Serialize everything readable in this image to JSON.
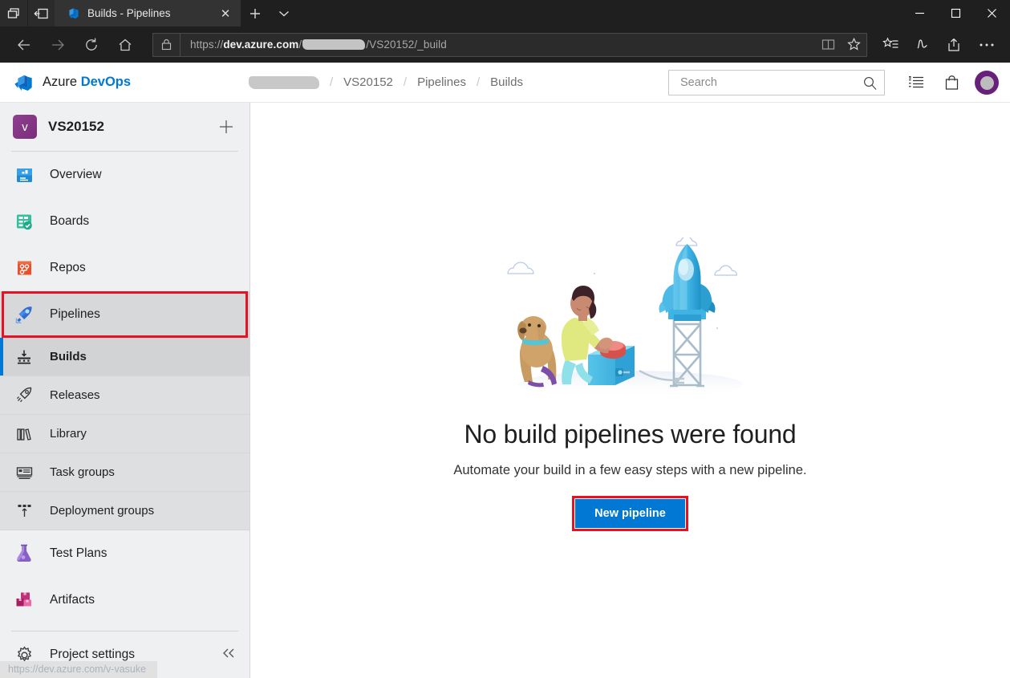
{
  "browser": {
    "tab": {
      "title": "Builds - Pipelines",
      "favicon_icon": "azure-devops-favicon",
      "close_icon": "close-icon"
    },
    "new_tab_label": "+",
    "tab_dropdown_icon": "chevron-down-icon",
    "titlebar_buttons": {
      "tabs_preview_icon": "tabs-preview-icon",
      "set_aside_icon": "set-tabs-aside-icon",
      "minimize": "—",
      "maximize": "□",
      "close": "✕"
    },
    "toolbar": {
      "back_icon": "back-arrow-icon",
      "forward_icon": "forward-arrow-icon",
      "refresh_icon": "refresh-icon",
      "home_icon": "home-icon",
      "lock_icon": "lock-icon",
      "reading_view_icon": "reading-view-icon",
      "favorite_icon": "star-icon",
      "hub_icon": "favorites-hub-icon",
      "notes_icon": "web-notes-icon",
      "share_icon": "share-icon",
      "more_icon": "more-ellipsis-icon"
    },
    "address": {
      "scheme": "https://",
      "domain": "dev.azure.com",
      "path_before_redaction": "/",
      "redacted_segment": true,
      "path_after_redaction": "/VS20152/_build"
    }
  },
  "ado_header": {
    "logo_icon": "azure-devops-logo",
    "brand_prefix": "Azure ",
    "brand_suffix": "DevOps",
    "breadcrumb": {
      "organization_redacted": true,
      "separator": "/",
      "items": [
        "VS20152",
        "Pipelines",
        "Builds"
      ]
    },
    "search": {
      "placeholder": "Search",
      "value": "",
      "icon": "search-icon"
    },
    "icons": [
      {
        "name": "backlog-list-icon",
        "label": "Work items"
      },
      {
        "name": "marketplace-bag-icon",
        "label": "Marketplace"
      }
    ],
    "avatar": {
      "name": "user-avatar",
      "color": "#68217a"
    }
  },
  "sidebar": {
    "project": {
      "initial": "v",
      "name": "VS20152",
      "add_icon": "plus-icon"
    },
    "items": [
      {
        "label": "Overview",
        "icon": "overview-icon",
        "color": "#0078d4"
      },
      {
        "label": "Boards",
        "icon": "boards-icon",
        "color": "#21a366"
      },
      {
        "label": "Repos",
        "icon": "repos-icon",
        "color": "#e8502a"
      },
      {
        "label": "Pipelines",
        "icon": "pipelines-rocket-icon",
        "color": "#2f6fd0",
        "highlighted": true
      }
    ],
    "sub_items": [
      {
        "label": "Builds",
        "icon": "builds-icon",
        "selected": true
      },
      {
        "label": "Releases",
        "icon": "releases-rocket-icon",
        "selected": false
      },
      {
        "label": "Library",
        "icon": "library-icon",
        "selected": false
      },
      {
        "label": "Task groups",
        "icon": "task-groups-icon",
        "selected": false
      },
      {
        "label": "Deployment groups",
        "icon": "deployment-groups-icon",
        "selected": false
      }
    ],
    "items_after": [
      {
        "label": "Test Plans",
        "icon": "test-plans-flask-icon",
        "color": "#8661c5"
      },
      {
        "label": "Artifacts",
        "icon": "artifacts-boxes-icon",
        "color": "#cd3f8e"
      }
    ],
    "footer": {
      "label": "Project settings",
      "icon": "gear-icon",
      "collapse_icon": "chevron-double-left-icon"
    },
    "status_bar_url": "https://dev.azure.com/v-vasuke"
  },
  "main": {
    "illustration_name": "rocket-launch-illustration",
    "title": "No build pipelines were found",
    "subtitle": "Automate your build in a few easy steps with a new pipeline.",
    "primary_button": "New pipeline"
  },
  "colors": {
    "accent": "#0078d4",
    "highlight_box": "#e81123",
    "sidebar_bg": "#eff0f1",
    "sub_nav_bg": "#dedfe0",
    "avatar_purple": "#68217a"
  }
}
